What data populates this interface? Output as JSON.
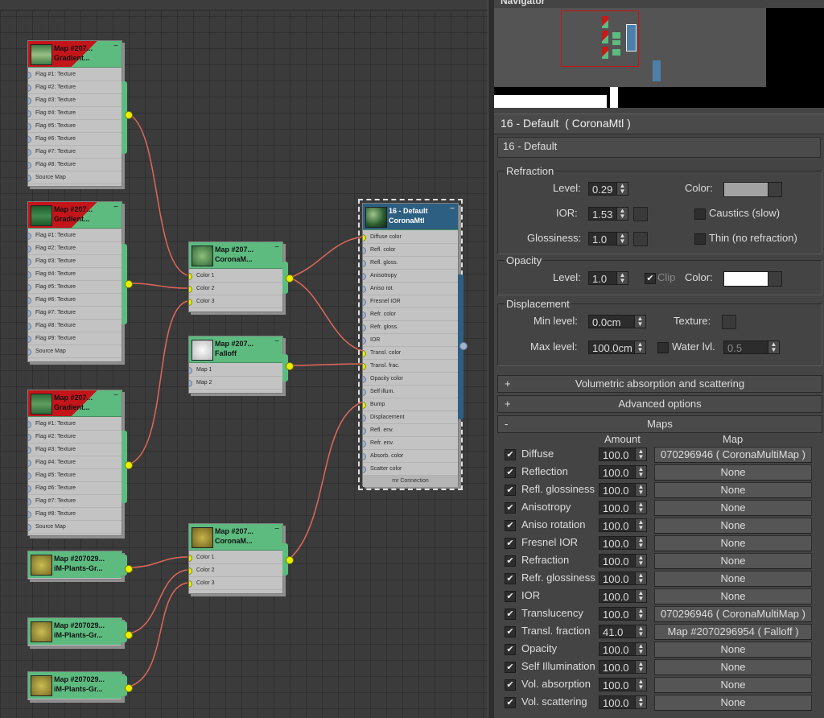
{
  "graph": {
    "gradient_nodes": [
      {
        "title1": "Map #207...",
        "title2": "Gradient...",
        "slots": [
          "Flag #1: Texture",
          "Flag #2: Texture",
          "Flag #3: Texture",
          "Flag #4: Texture",
          "Flag #5: Texture",
          "Flag #6: Texture",
          "Flag #7: Texture",
          "Flag #8: Texture",
          "Source Map"
        ]
      },
      {
        "title1": "Map #207...",
        "title2": "Gradient...",
        "slots": [
          "Flag #1: Texture",
          "Flag #2: Texture",
          "Flag #3: Texture",
          "Flag #4: Texture",
          "Flag #5: Texture",
          "Flag #6: Texture",
          "Flag #7: Texture",
          "Flag #8: Texture",
          "Flag #9: Texture",
          "Source Map"
        ]
      },
      {
        "title1": "Map #207...",
        "title2": "Gradient...",
        "slots": [
          "Flag #1: Texture",
          "Flag #2: Texture",
          "Flag #3: Texture",
          "Flag #4: Texture",
          "Flag #5: Texture",
          "Flag #6: Texture",
          "Flag #7: Texture",
          "Flag #8: Texture",
          "Source Map"
        ]
      }
    ],
    "multimap_top": {
      "title1": "Map #207...",
      "title2": "CoronaM...",
      "slots": [
        "Color 1",
        "Color 2",
        "Color 3"
      ]
    },
    "falloff": {
      "title1": "Map #207...",
      "title2": "Falloff",
      "slots": [
        "Map 1",
        "Map 2"
      ]
    },
    "multimap_bottom": {
      "title1": "Map #207...",
      "title2": "CoronaM...",
      "slots": [
        "Color 1",
        "Color 2",
        "Color 3"
      ]
    },
    "bitmaps": [
      {
        "title1": "Map #207029...",
        "title2": "iM-Plants-Gr..."
      },
      {
        "title1": "Map #207029...",
        "title2": "iM-Plants-Gr..."
      },
      {
        "title1": "Map #207029...",
        "title2": "iM-Plants-Gr..."
      }
    ],
    "material": {
      "title1": "16 - Default",
      "title2": "CoronaMtl",
      "slots": [
        "Diffuse color",
        "Refl. color",
        "Refl. gloss.",
        "Anisotropy",
        "Aniso rot.",
        "Fresnel IOR",
        "Refr. color",
        "Refr. gloss.",
        "IOR",
        "Transl. color",
        "Transl. frac.",
        "Opacity color",
        "Self illum.",
        "Bump",
        "Displacement",
        "Refl. env.",
        "Refr. env.",
        "Absorb. color",
        "Scatter color"
      ],
      "footer": "mr Connection"
    }
  },
  "navigator": {
    "title": "Navigator"
  },
  "panel": {
    "header": "16 - Default  ( CoronaMtl )",
    "name": "16 - Default",
    "refraction": {
      "title": "Refraction",
      "level_label": "Level:",
      "level": "0.29",
      "ior_label": "IOR:",
      "ior": "1.53",
      "gloss_label": "Glossiness:",
      "gloss": "1.0",
      "color_label": "Color:",
      "caustics_label": "Caustics (slow)",
      "thin_label": "Thin (no refraction)",
      "color": "#a3a3a3"
    },
    "opacity": {
      "title": "Opacity",
      "level_label": "Level:",
      "level": "1.0",
      "clip_label": "Clip",
      "color_label": "Color:",
      "color": "#ffffff"
    },
    "displacement": {
      "title": "Displacement",
      "min_label": "Min level:",
      "min": "0.0cm",
      "texture_label": "Texture:",
      "max_label": "Max level:",
      "max": "100.0cm",
      "water_label": "Water lvl.",
      "water": "0.5"
    },
    "rollouts": [
      {
        "sign": "+",
        "label": "Volumetric absorption and scattering"
      },
      {
        "sign": "+",
        "label": "Advanced options"
      },
      {
        "sign": "-",
        "label": "Maps"
      }
    ],
    "maps": {
      "col_amount": "Amount",
      "col_map": "Map",
      "rows": [
        {
          "name": "Diffuse",
          "amount": "100.0",
          "map": "070296946  ( CoronaMultiMap )"
        },
        {
          "name": "Reflection",
          "amount": "100.0",
          "map": "None"
        },
        {
          "name": "Refl. glossiness",
          "amount": "100.0",
          "map": "None"
        },
        {
          "name": "Anisotropy",
          "amount": "100.0",
          "map": "None"
        },
        {
          "name": "Aniso rotation",
          "amount": "100.0",
          "map": "None"
        },
        {
          "name": "Fresnel IOR",
          "amount": "100.0",
          "map": "None"
        },
        {
          "name": "Refraction",
          "amount": "100.0",
          "map": "None"
        },
        {
          "name": "Refr. glossiness",
          "amount": "100.0",
          "map": "None"
        },
        {
          "name": "IOR",
          "amount": "100.0",
          "map": "None"
        },
        {
          "name": "Translucency",
          "amount": "100.0",
          "map": "070296946  ( CoronaMultiMap )"
        },
        {
          "name": "Transl. fraction",
          "amount": "41.0",
          "map": "Map #2070296954  ( Falloff )"
        },
        {
          "name": "Opacity",
          "amount": "100.0",
          "map": "None"
        },
        {
          "name": "Self Illumination",
          "amount": "100.0",
          "map": "None"
        },
        {
          "name": "Vol. absorption",
          "amount": "100.0",
          "map": "None"
        },
        {
          "name": "Vol. scattering",
          "amount": "100.0",
          "map": "None"
        }
      ]
    }
  },
  "colors": {
    "node_header": "#5dbb80",
    "material_header": "#2d5f82",
    "wire": "#e0675a",
    "socket_active": "#e8f000"
  }
}
